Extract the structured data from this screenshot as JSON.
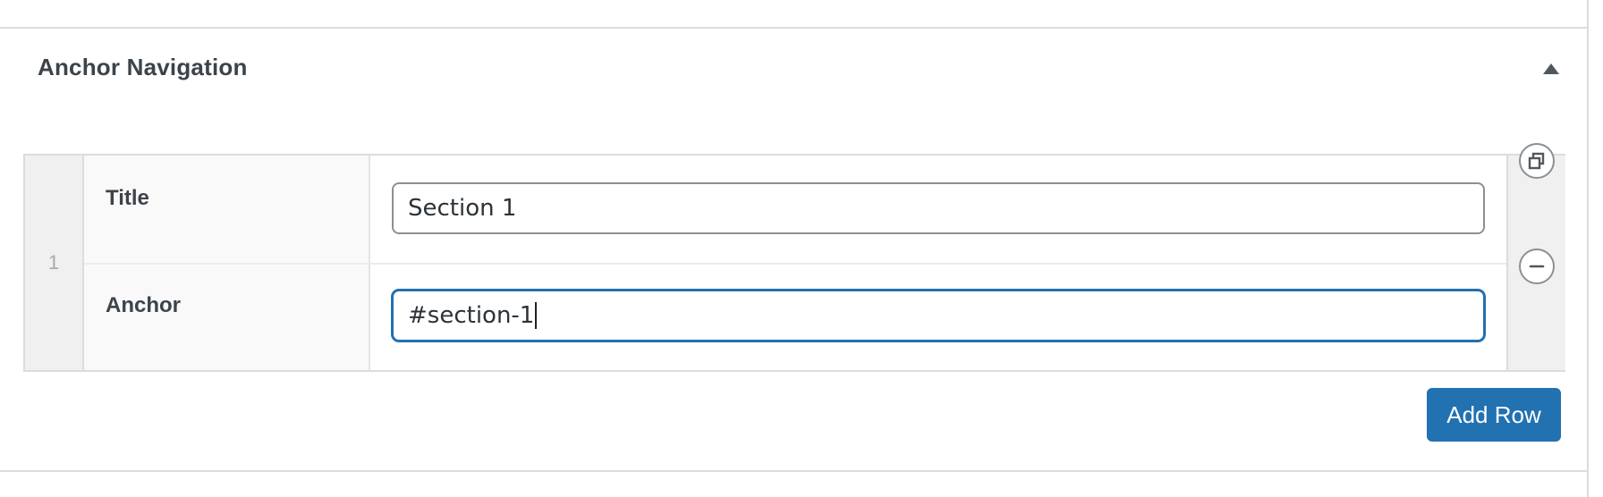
{
  "section": {
    "title": "Anchor Navigation",
    "toggle_icon": "triangle-up-icon"
  },
  "repeater": {
    "rows": [
      {
        "index": "1",
        "fields": [
          {
            "label": "Title",
            "value": "Section 1"
          },
          {
            "label": "Anchor",
            "value": "#section-1",
            "focused": true
          }
        ],
        "actions": [
          "duplicate-icon",
          "remove-icon"
        ]
      }
    ]
  },
  "buttons": {
    "add_row": "Add Row"
  },
  "colors": {
    "accent": "#2271b1",
    "border": "#dcdcde",
    "muted_bg": "#f0f0f1"
  }
}
